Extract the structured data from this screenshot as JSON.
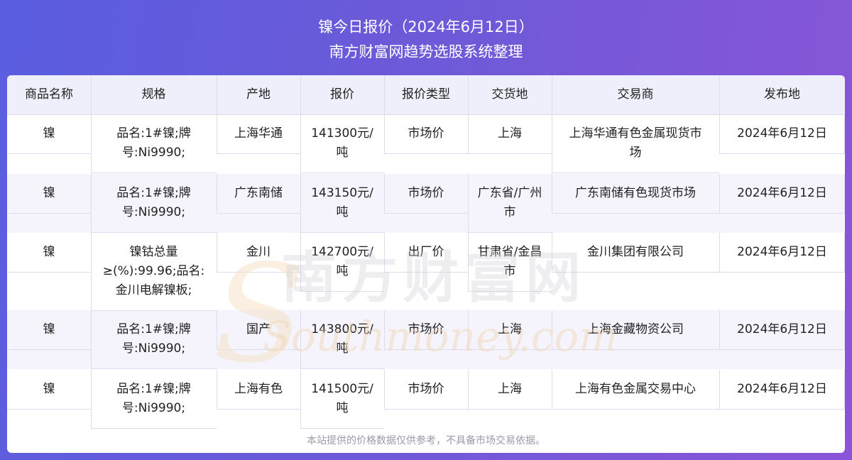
{
  "header": {
    "title": "镍今日报价（2024年6月12日）",
    "subtitle": "南方财富网趋势选股系统整理"
  },
  "table": {
    "columns": [
      "商品名称",
      "规格",
      "产地",
      "报价",
      "报价类型",
      "交货地",
      "交易商",
      "发布地"
    ],
    "rows": [
      {
        "name": "镍",
        "spec_lines": [
          "品名:1#镍;牌",
          "号:Ni9990;"
        ],
        "origin": "上海华通",
        "price_lines": [
          "141300元/",
          "吨"
        ],
        "price_type": "市场价",
        "delivery_lines": [
          "上海"
        ],
        "trader_lines": [
          "上海华通有色金属现货市",
          "场"
        ],
        "publish": "2024年6月12日"
      },
      {
        "name": "镍",
        "spec_lines": [
          "品名:1#镍;牌",
          "号:Ni9990;"
        ],
        "origin": "广东南储",
        "price_lines": [
          "143150元/",
          "吨"
        ],
        "price_type": "市场价",
        "delivery_lines": [
          "广东省/广州",
          "市"
        ],
        "trader_lines": [
          "广东南储有色现货市场"
        ],
        "publish": "2024年6月12日"
      },
      {
        "name": "镍",
        "spec_lines": [
          "镍钴总量",
          "≥(%):99.96;品名:",
          "金川电解镍板;"
        ],
        "origin": "金川",
        "price_lines": [
          "142700元/",
          "吨"
        ],
        "price_type": "出厂价",
        "delivery_lines": [
          "甘肃省/金昌",
          "市"
        ],
        "trader_lines": [
          "金川集团有限公司"
        ],
        "publish": "2024年6月12日"
      },
      {
        "name": "镍",
        "spec_lines": [
          "品名:1#镍;牌",
          "号:Ni9990;"
        ],
        "origin": "国产",
        "price_lines": [
          "143800元/",
          "吨"
        ],
        "price_type": "市场价",
        "delivery_lines": [
          "上海"
        ],
        "trader_lines": [
          "上海金藏物资公司"
        ],
        "publish": "2024年6月12日"
      },
      {
        "name": "镍",
        "spec_lines": [
          "品名:1#镍;牌",
          "号:Ni9990;"
        ],
        "origin": "上海有色",
        "price_lines": [
          "141500元/",
          "吨"
        ],
        "price_type": "市场价",
        "delivery_lines": [
          "上海"
        ],
        "trader_lines": [
          "上海有色金属交易中心"
        ],
        "publish": "2024年6月12日"
      }
    ]
  },
  "watermark": {
    "cn": "南方财富网",
    "en": "Southmoney.com"
  },
  "footer": {
    "disclaimer": "本站提供的价格数据仅供参考，不具备市场交易依据。"
  },
  "colors": {
    "header_bg_start": "#5a5ee0",
    "header_bg_end": "#8a55d8",
    "table_header_bg": "#efeffb",
    "band_bg": "#f5f4fc",
    "grid_line": "#dcdcec"
  }
}
